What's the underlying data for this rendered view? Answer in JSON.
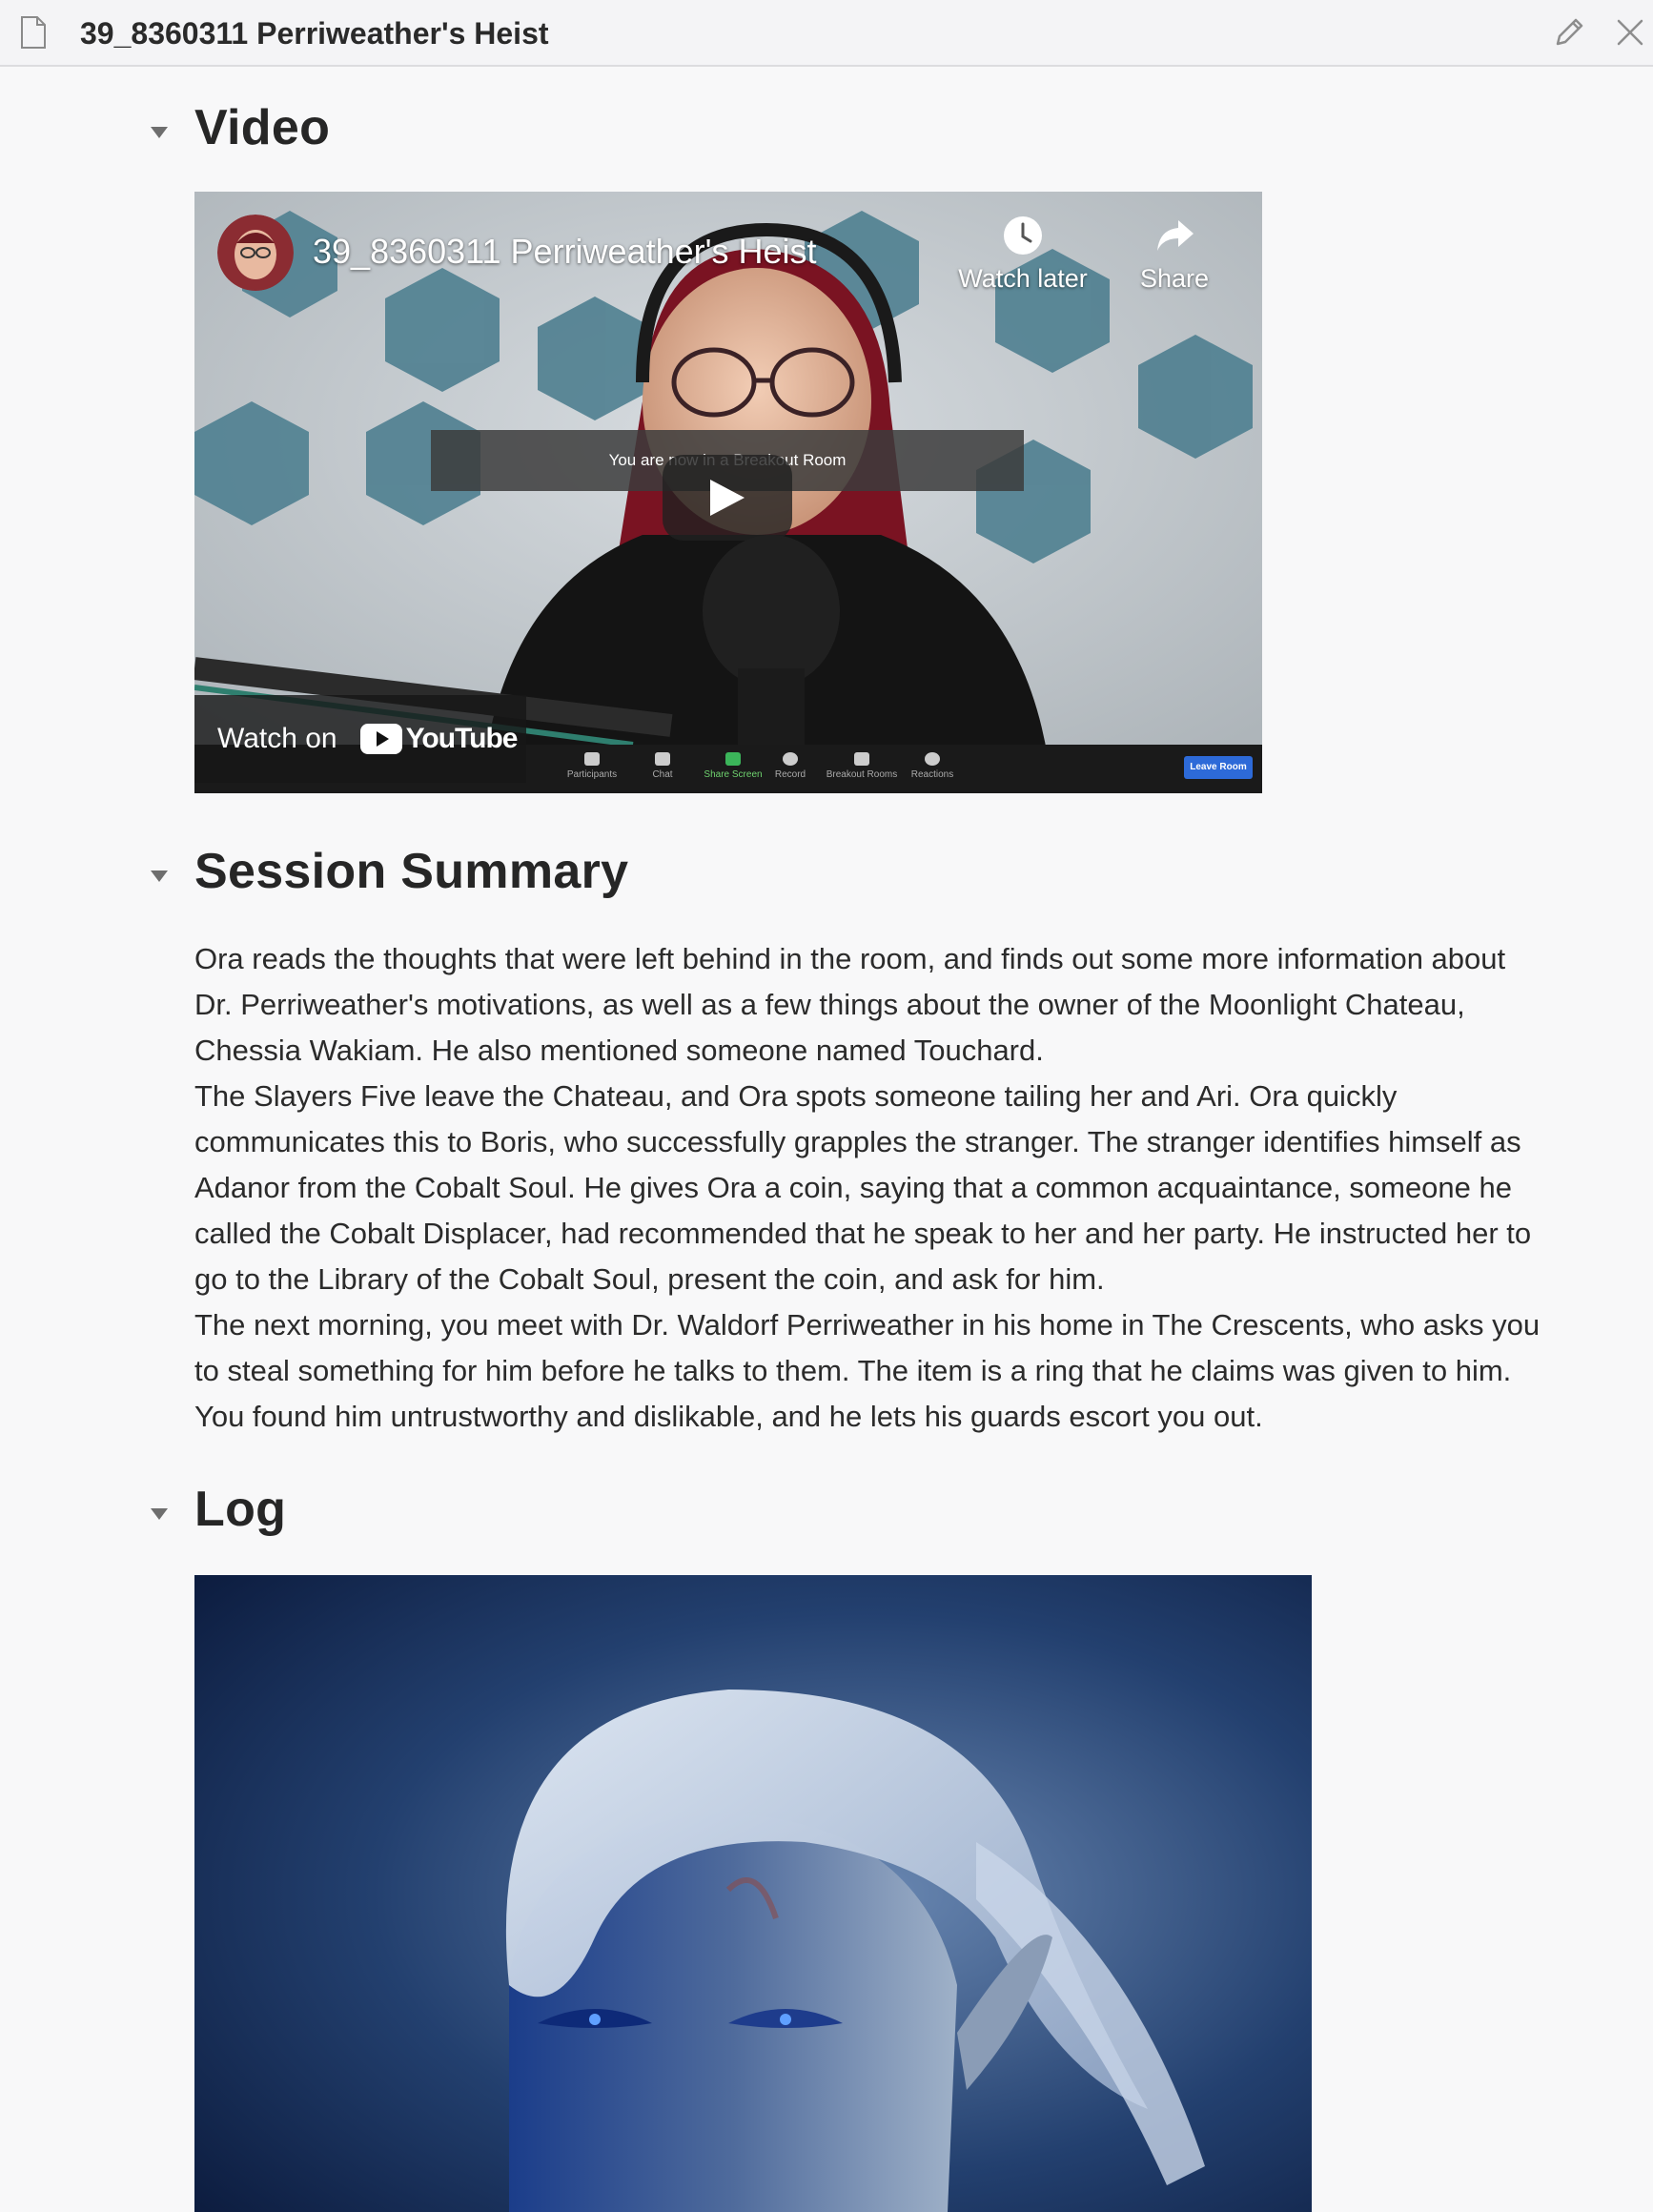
{
  "window": {
    "title": "39_8360311 Perriweather's Heist"
  },
  "sections": {
    "video": {
      "heading": "Video"
    },
    "summary": {
      "heading": "Session Summary"
    },
    "log": {
      "heading": "Log"
    }
  },
  "video": {
    "title": "39_8360311 Perriweather's Heist",
    "watch_later_label": "Watch later",
    "share_label": "Share",
    "overlay_banner": "You are now in a Breakout Room",
    "watch_on_label": "Watch on",
    "youtube_wordmark": "YouTube",
    "zoom_toolbar": {
      "items": [
        "Participants",
        "Chat",
        "Share Screen",
        "Record",
        "Breakout Rooms",
        "Reactions"
      ],
      "leave_label": "Leave Room"
    }
  },
  "summary": {
    "paragraphs": [
      "Ora reads the thoughts that were left behind in the room, and finds out some more information about Dr. Perriweather's motivations, as well as a few things about the owner of the Moonlight Chateau, Chessia Wakiam. He also mentioned someone named Touchard.",
      "The Slayers Five leave the Chateau, and Ora spots someone tailing her and Ari. Ora quickly communicates this to Boris, who successfully grapples the stranger. The stranger identifies himself as Adanor from the Cobalt Soul. He gives Ora a coin, saying that a common acquaintance, someone he called the Cobalt Displacer, had recommended that he speak to her and her party. He instructed her to go to the Library of the Cobalt Soul, present the coin, and ask for him.",
      "The next morning, you meet with Dr. Waldorf Perriweather in his home in The Crescents, who asks you to steal something for him before he talks to them. The item is a ring that he claims was given to him. You found him untrustworthy and dislikable, and he lets his guards escort you out."
    ]
  },
  "colors": {
    "page_background": "#f8f8f9",
    "youtube_red": "#ff0000",
    "zoom_green": "#3bb55a",
    "zoom_blue": "#2d6ad8"
  },
  "icons": {
    "document": "document-icon",
    "edit": "pencil-icon",
    "close": "close-icon",
    "collapse": "caret-down-icon",
    "watch_later": "clock-icon",
    "share": "share-arrow-icon",
    "play": "play-icon"
  }
}
